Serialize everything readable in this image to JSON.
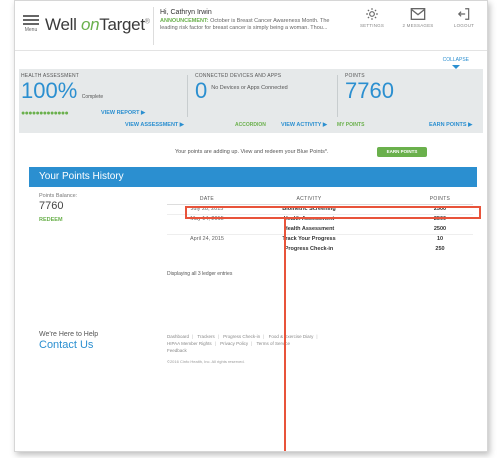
{
  "header": {
    "menu_label": "Menu",
    "logo_prefix": "Well ",
    "logo_on": "on",
    "logo_suffix": "Target",
    "logo_mark": "®",
    "greeting": "Hi, Cathryn Irwin",
    "announcement_label": "ANNOUNCEMENT:",
    "announcement_text": "October is Breast Cancer Awareness Month. The leading risk factor for breast cancer is simply being a woman. Thou...",
    "icons": [
      {
        "name": "settings-icon",
        "label": "SETTINGS"
      },
      {
        "name": "messages-icon",
        "label": "2 MESSAGES"
      },
      {
        "name": "logout-icon",
        "label": "LOGOUT"
      }
    ]
  },
  "summary": {
    "collapse": "COLLAPSE",
    "health_assessment": {
      "caption": "HEALTH ASSESSMENT",
      "value": "100%",
      "status": "Complete",
      "progress": 1.0,
      "view_report": "VIEW REPORT ▶",
      "view_assessment": "VIEW ASSESSMENT ▶"
    },
    "devices": {
      "caption": "CONNECTED DEVICES AND APPS",
      "count": "0",
      "text": "No Devices or Apps Connected",
      "accordion": "ACCORDION",
      "view_activity": "VIEW ACTIVITY ▶",
      "my_points": "MY POINTS"
    },
    "points": {
      "caption": "POINTS",
      "value": "7760",
      "earn_points": "EARN POINTS ▶"
    }
  },
  "banner": {
    "message": "Your points are adding up. View and redeem your Blue Points*.",
    "earn_button": "EARN POINTS"
  },
  "history": {
    "title": "Your Points History",
    "balance_caption": "Points Balance:",
    "balance_value": "7760",
    "redeem": "REDEEM",
    "columns": [
      "DATE",
      "ACTIVITY",
      "POINTS"
    ],
    "rows": [
      {
        "date": "July 28, 2015",
        "activity": "Biometric Screening",
        "points": "2500"
      },
      {
        "date": "May 14, 2015",
        "activity": "Health Assessment",
        "points": "2500"
      },
      {
        "date": "",
        "activity": "Health Assessment",
        "points": "2500"
      },
      {
        "date": "April 24, 2015",
        "activity": "Track Your Progress",
        "points": "10"
      },
      {
        "date": "",
        "activity": "Progress Check-in",
        "points": "250"
      }
    ],
    "footer_note": "Displaying all 3 ledger entries"
  },
  "footer": {
    "help_title": "We're Here to Help",
    "contact": "Contact Us",
    "links_row1": [
      "Dashboard",
      "Trackers",
      "Progress Check-in",
      "Food & Exercise Diary"
    ],
    "links_row2": [
      "HIPAA Member Rights",
      "Privacy Policy",
      "Terms of Service"
    ],
    "links_row3": [
      "Feedback"
    ],
    "copyright": "©2016 Cinfo Health, Inc. All rights reserved."
  }
}
